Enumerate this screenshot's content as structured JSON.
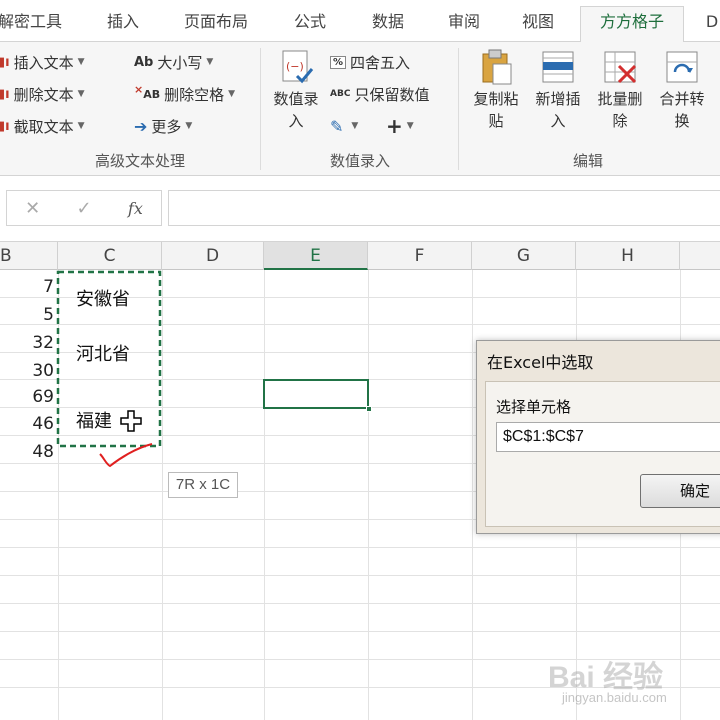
{
  "tabs": [
    {
      "label": "解密工具",
      "active": false
    },
    {
      "label": "插入",
      "active": false
    },
    {
      "label": "页面布局",
      "active": false
    },
    {
      "label": "公式",
      "active": false
    },
    {
      "label": "数据",
      "active": false
    },
    {
      "label": "审阅",
      "active": false
    },
    {
      "label": "视图",
      "active": false
    },
    {
      "label": "方方格子",
      "active": true
    },
    {
      "label": "D",
      "active": false
    }
  ],
  "ribbon": {
    "text_group": {
      "label": "高级文本处理",
      "insert_text": "插入文本",
      "delete_text": "删除文本",
      "cut_text": "截取文本",
      "case": "大小写",
      "case_icon_text": "Ab",
      "remove_space": "删除空格",
      "remove_space_icon_text": "AB",
      "more": "更多"
    },
    "value_group": {
      "label": "数值录入",
      "value_entry": "数值录入",
      "round": "四舍五入",
      "round_icon_text": "%",
      "keep_value": "只保留数值",
      "keep_value_icon_text": "ABC",
      "value_entry_icon_text": "(−)",
      "plus": "+"
    },
    "edit_group": {
      "label": "编辑",
      "copy_paste": "复制粘贴",
      "add_insert": "新增插入",
      "batch_delete": "批量删除",
      "merge_convert": "合并转换"
    }
  },
  "formula_bar": {
    "cancel": "✕",
    "confirm": "✓",
    "fx": "fx",
    "value": ""
  },
  "columns": [
    "B",
    "C",
    "D",
    "E",
    "F",
    "G",
    "H"
  ],
  "selected_column": "E",
  "cells_b": [
    "7",
    "5",
    "32",
    "30",
    "69",
    "46",
    "48"
  ],
  "cells_c": [
    "安徽省",
    "河北省",
    "福建"
  ],
  "size_tooltip": "7R x 1C",
  "dialog": {
    "title": "在Excel中选取",
    "label": "选择单元格",
    "value": "$C$1:$C$7",
    "ok": "确定"
  },
  "watermark": {
    "text": "Bai 经验",
    "url": "jingyan.baidu.com"
  },
  "colors": {
    "accent": "#217346",
    "tab_active": "#1e6e3c",
    "annotation": "#e02020"
  }
}
